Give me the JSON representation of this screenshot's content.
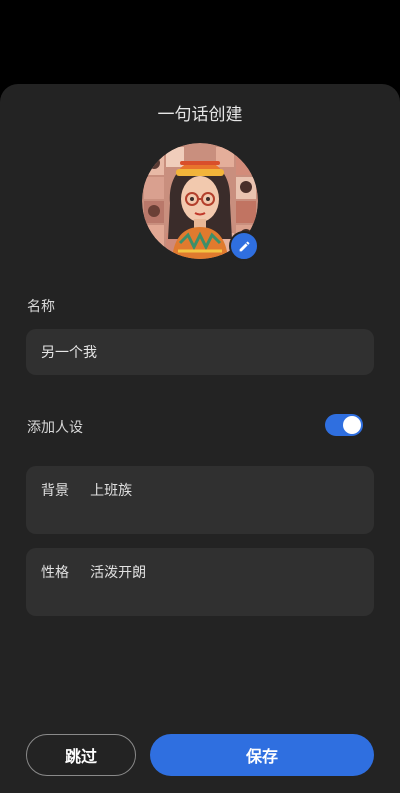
{
  "sheet": {
    "title": "一句话创建"
  },
  "avatar": {
    "edit_icon": "pencil-icon"
  },
  "name": {
    "label": "名称",
    "value": "另一个我"
  },
  "persona": {
    "label": "添加人设",
    "enabled": true,
    "traits": [
      {
        "key": "背景",
        "value": "上班族"
      },
      {
        "key": "性格",
        "value": "活泼开朗"
      }
    ]
  },
  "actions": {
    "skip_label": "跳过",
    "save_label": "保存"
  },
  "colors": {
    "accent": "#2f6fe0",
    "sheet_bg": "#232323",
    "field_bg": "#303030"
  }
}
